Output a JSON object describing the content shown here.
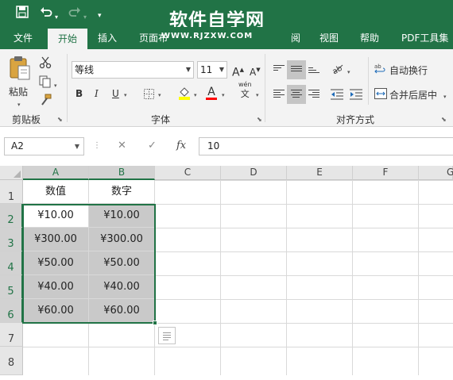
{
  "watermark": {
    "title": "软件自学网",
    "url": "WWW.RJZXW.COM"
  },
  "quick_access": {
    "save_icon": "save-icon",
    "undo_icon": "undo-icon",
    "redo_icon": "redo-icon",
    "customize_icon": "customize-icon"
  },
  "tabs": [
    {
      "label": "文件"
    },
    {
      "label": "开始",
      "active": true
    },
    {
      "label": "插入"
    },
    {
      "label": "页面布"
    },
    {
      "label": "阅"
    },
    {
      "label": "视图"
    },
    {
      "label": "帮助"
    },
    {
      "label": "PDF工具集"
    }
  ],
  "ribbon": {
    "clipboard": {
      "paste_label": "粘贴",
      "group_label": "剪贴板"
    },
    "font": {
      "font_name": "等线",
      "font_size": "11",
      "bold": "B",
      "italic": "I",
      "underline": "U",
      "grow": "A",
      "shrink": "A",
      "font_color_letter": "A",
      "phonetic_top": "wén",
      "phonetic_bottom": "文",
      "group_label": "字体"
    },
    "alignment": {
      "wrap_text": "自动换行",
      "merge_center": "合并后居中",
      "group_label": "对齐方式"
    }
  },
  "formula_bar": {
    "name_box": "A2",
    "cancel": "✕",
    "enter": "✓",
    "fx": "fx",
    "value": "10"
  },
  "sheet": {
    "columns": [
      "A",
      "B",
      "C",
      "D",
      "E",
      "F",
      "G"
    ],
    "rows": [
      "1",
      "2",
      "3",
      "4",
      "5",
      "6",
      "7",
      "8"
    ],
    "header_row": [
      "数值",
      "数字"
    ],
    "data": [
      [
        "¥10.00",
        "¥10.00"
      ],
      [
        "¥300.00",
        "¥300.00"
      ],
      [
        "¥50.00",
        "¥50.00"
      ],
      [
        "¥40.00",
        "¥40.00"
      ],
      [
        "¥60.00",
        "¥60.00"
      ]
    ]
  },
  "colors": {
    "accent": "#217346",
    "selection_fill": "#c9c9c9",
    "font_color": "#ff0000",
    "highlight": "#ffff00"
  }
}
